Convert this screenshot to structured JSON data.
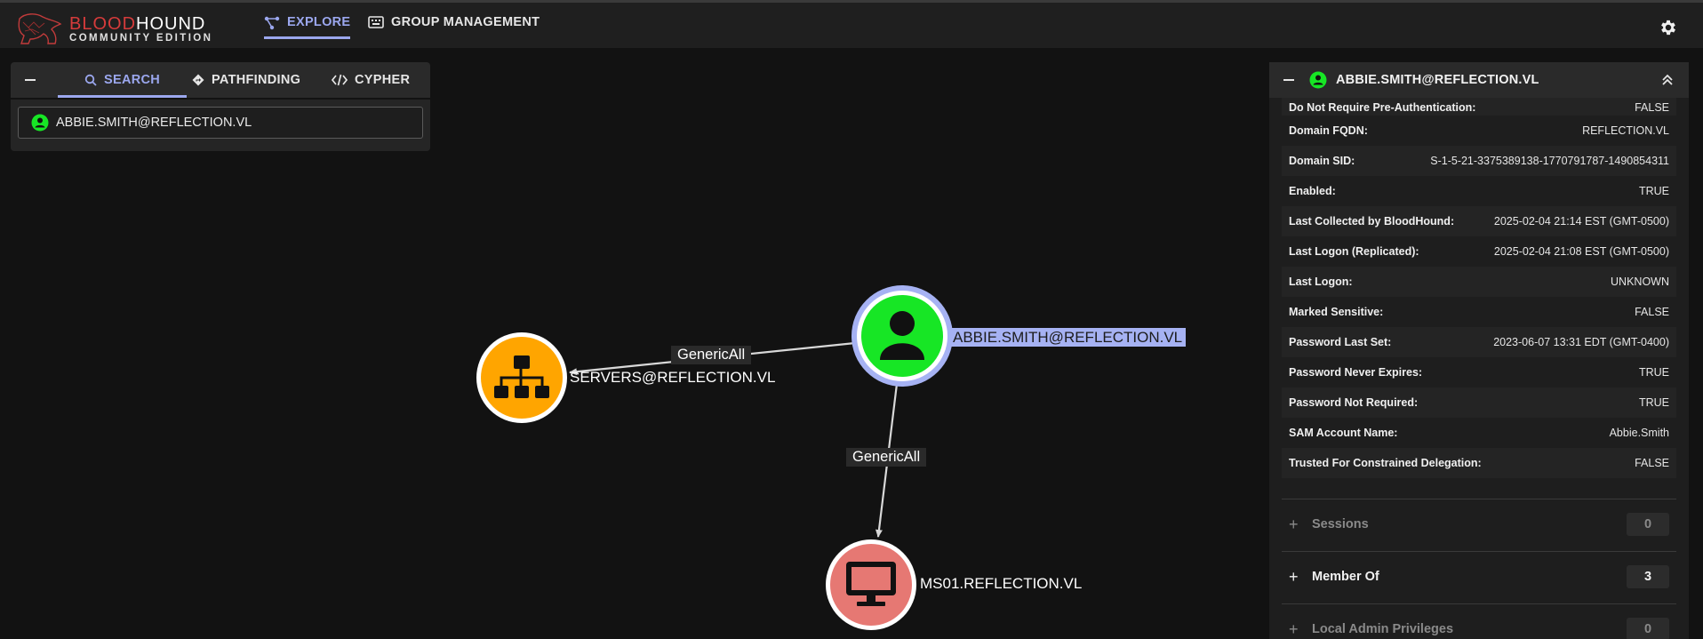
{
  "app": {
    "logo_word_1": "BLOOD",
    "logo_word_2": "HOUND",
    "logo_sub": "COMMUNITY EDITION",
    "accent": "#9ba7ee",
    "brand_red": "#d63b3b"
  },
  "nav": {
    "explore": "EXPLORE",
    "group_management": "GROUP MANAGEMENT",
    "settings_icon": "gear-icon"
  },
  "search_panel": {
    "tabs": [
      "SEARCH",
      "PATHFINDING",
      "CYPHER"
    ],
    "active_tab": "SEARCH",
    "query_value": "ABBIE.SMITH@REFLECTION.VL"
  },
  "graph": {
    "nodes": [
      {
        "id": "user",
        "label": "ABBIE.SMITH@REFLECTION.VL",
        "type": "User",
        "color": "#17e625",
        "selected": true
      },
      {
        "id": "group",
        "label": "SERVERS@REFLECTION.VL",
        "type": "Group",
        "color": "#ffa500"
      },
      {
        "id": "computer",
        "label": "MS01.REFLECTION.VL",
        "type": "Computer",
        "color": "#e67873"
      }
    ],
    "edges": [
      {
        "from": "user",
        "to": "group",
        "label": "GenericAll"
      },
      {
        "from": "user",
        "to": "computer",
        "label": "GenericAll"
      }
    ]
  },
  "details": {
    "title": "ABBIE.SMITH@REFLECTION.VL",
    "properties": [
      {
        "key": "Do Not Require Pre-Authentication:",
        "value": "FALSE"
      },
      {
        "key": "Domain FQDN:",
        "value": "REFLECTION.VL"
      },
      {
        "key": "Domain SID:",
        "value": "S-1-5-21-3375389138-1770791787-1490854311"
      },
      {
        "key": "Enabled:",
        "value": "TRUE"
      },
      {
        "key": "Last Collected by BloodHound:",
        "value": "2025-02-04 21:14 EST (GMT-0500)"
      },
      {
        "key": "Last Logon (Replicated):",
        "value": "2025-02-04 21:08 EST (GMT-0500)"
      },
      {
        "key": "Last Logon:",
        "value": "UNKNOWN"
      },
      {
        "key": "Marked Sensitive:",
        "value": "FALSE"
      },
      {
        "key": "Password Last Set:",
        "value": "2023-06-07 13:31 EDT (GMT-0400)"
      },
      {
        "key": "Password Never Expires:",
        "value": "TRUE"
      },
      {
        "key": "Password Not Required:",
        "value": "TRUE"
      },
      {
        "key": "SAM Account Name:",
        "value": "Abbie.Smith"
      },
      {
        "key": "Trusted For Constrained Delegation:",
        "value": "FALSE"
      }
    ],
    "sections": [
      {
        "label": "Sessions",
        "count": "0",
        "enabled": false
      },
      {
        "label": "Member Of",
        "count": "3",
        "enabled": true
      },
      {
        "label": "Local Admin Privileges",
        "count": "0",
        "enabled": false
      }
    ]
  }
}
